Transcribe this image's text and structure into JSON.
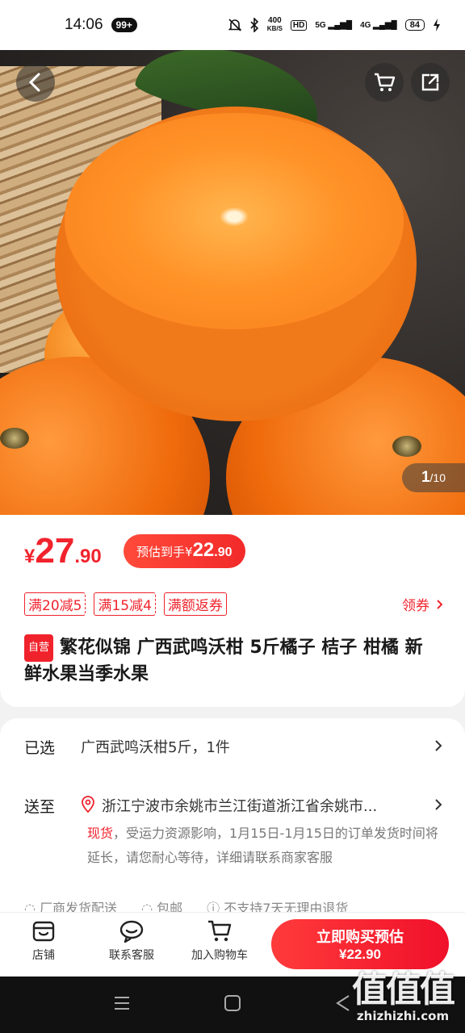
{
  "status_bar": {
    "time": "14:06",
    "notif_badge": "99+",
    "net_speed_value": "400",
    "net_speed_unit": "KB/S",
    "hd_label": "HD",
    "signal_1": "5G",
    "signal_2": "4G",
    "battery": "84"
  },
  "gallery": {
    "current": "1",
    "total": "/10"
  },
  "price": {
    "currency": "¥",
    "integer": "27",
    "decimal": ".90",
    "estimate_label": "预估到手",
    "estimate_currency": "¥",
    "estimate_integer": "22",
    "estimate_decimal": ".90"
  },
  "coupons": [
    "满20减5",
    "满15减4",
    "满额返券"
  ],
  "get_coupon": "领券",
  "product": {
    "self_tag": "自营",
    "title": "繁花似锦 广西武鸣沃柑 5斤橘子 桔子 柑橘 新鲜水果当季水果"
  },
  "selected": {
    "label": "已选",
    "value": "广西武鸣沃柑5斤，1件"
  },
  "shipping": {
    "label": "送至",
    "address": "浙江宁波市余姚市兰江街道浙江省余姚市...",
    "stock": "现货",
    "notice": "，受运力资源影响，1月15日-1月15日的订单发货时间将延长，请您耐心等待，详细请联系商家客服"
  },
  "services": [
    "厂商发货配送",
    "包邮",
    "不支持7天无理由退货"
  ],
  "actions": {
    "store": "店铺",
    "service": "联系客服",
    "cart": "加入购物车",
    "buy_line1": "立即购买预估",
    "buy_line2": "¥22.90"
  },
  "watermark": {
    "big": "值值值",
    "small": "zhizhizhi.com"
  },
  "colors": {
    "accent": "#f0232d",
    "bg": "#f2f2f2"
  }
}
